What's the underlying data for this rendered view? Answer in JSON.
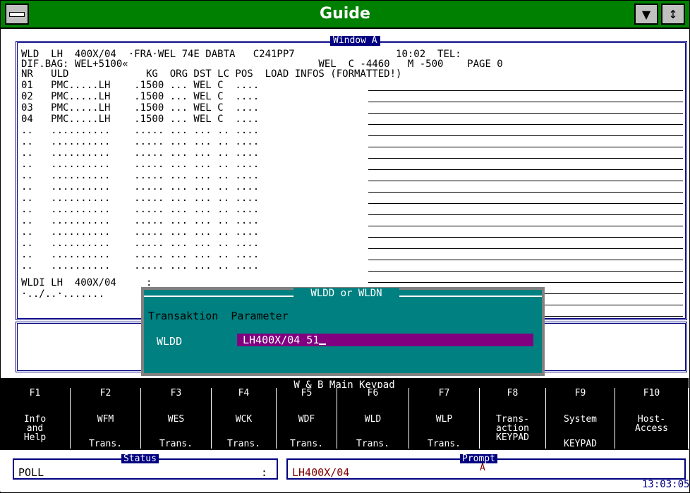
{
  "window": {
    "title": "Guide"
  },
  "window_a": {
    "label": "Window A",
    "header": [
      "WLD  LH  400X/04  ·FRA·WEL 74E DABTA   C241PP7                 10:02  TEL:",
      "DIF.BAG: WEL+5100«                                WEL  C -4460   M -500    PAGE 0",
      "NR   ULD             KG  ORG DST LC POS  LOAD INFOS (FORMATTED!)"
    ],
    "rows": [
      "01   PMC.....LH    .1500 ... WEL C  ....",
      "02   PMC.....LH    .1500 ... WEL C  ....",
      "03   PMC.....LH    .1500 ... WEL C  ....",
      "04   PMC.....LH    .1500 ... WEL C  ....",
      "..   ..........    ..... ... ... .. ....",
      "..   ..........    ..... ... ... .. ....",
      "..   ..........    ..... ... ... .. ....",
      "..   ..........    ..... ... ... .. ....",
      "..   ..........    ..... ... ... .. ....",
      "..   ..........    ..... ... ... .. ....",
      "..   ..........    ..... ... ... .. ....",
      "..   ..........    ..... ... ... .. ....",
      "..   ..........    ..... ... ... .. ....",
      "..   ..........    ..... ... ... .. ....",
      "..   ..........    ..... ... ... .. ....",
      "..   ..........    ..... ... ... .. ....",
      "..   ..........    ..... ... ... .. ...."
    ],
    "footer1": "WLDI LH  400X/04     :",
    "footer2": "·../..·......."
  },
  "dialog": {
    "title": "WLDD or WLDN",
    "head_transaction": "Transaktion",
    "head_parameter": "Parameter",
    "transaction": "WLDD",
    "parameter": "LH400X/04 51"
  },
  "keypad": {
    "title": "W & B Main Keypad",
    "keys": [
      {
        "fk": "F1",
        "label": "Info\nand\nHelp",
        "bottom": ""
      },
      {
        "fk": "F2",
        "label": "WFM",
        "bottom": "Trans."
      },
      {
        "fk": "F3",
        "label": "WES",
        "bottom": "Trans."
      },
      {
        "fk": "F4",
        "label": "WCK",
        "bottom": "Trans."
      },
      {
        "fk": "F5",
        "label": "WDF",
        "bottom": "Trans."
      },
      {
        "fk": "F6",
        "label": "WLD",
        "bottom": "Trans."
      },
      {
        "fk": "F7",
        "label": "WLP",
        "bottom": "Trans."
      },
      {
        "fk": "F8",
        "label": "Trans-\naction\nKEYPAD",
        "bottom": ""
      },
      {
        "fk": "F9",
        "label": "System",
        "bottom": "KEYPAD"
      },
      {
        "fk": "F10",
        "label": "Host-\nAccess",
        "bottom": ""
      }
    ]
  },
  "status": {
    "label": "Status",
    "value": "POLL",
    "mark": ":",
    "prompt_label": "Prompt",
    "prompt_value": "LH400X/04",
    "prompt_mode": "A",
    "clock": "13:03:05"
  },
  "colors": {
    "titlebar": "#008000",
    "accent": "#000080",
    "dialog": "#008080",
    "field": "#800080"
  }
}
